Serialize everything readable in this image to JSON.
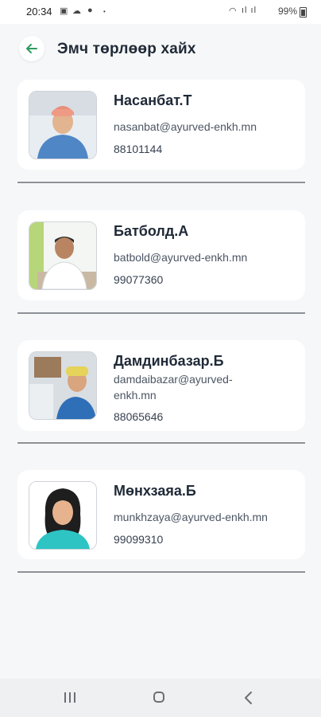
{
  "status_bar": {
    "time": "20:34",
    "battery": "99%"
  },
  "header": {
    "title": "Эмч төрлөөр хайх"
  },
  "doctors": [
    {
      "name": "Насанбат.Т",
      "email": "nasanbat@ayurved-enkh.mn",
      "phone": "88101144"
    },
    {
      "name": "Батболд.А",
      "email": "batbold@ayurved-enkh.mn",
      "phone": "99077360"
    },
    {
      "name": "Дамдинбазар.Б",
      "email_line1": "damdaibazar@ayurved-",
      "email_line2": "enkh.mn",
      "phone": "88065646"
    },
    {
      "name": "Мөнхзаяа.Б",
      "email": "munkhzaya@ayurved-enkh.mn",
      "phone": "99099310"
    }
  ],
  "colors": {
    "background": "#f6f7f8",
    "card": "#ffffff",
    "accent_green": "#2e9b5f",
    "divider": "#8d9197"
  },
  "icons": {
    "back": "arrow-left-icon",
    "nav_recent": "recent-apps-icon",
    "nav_home": "home-icon",
    "nav_back": "chevron-left-icon"
  }
}
